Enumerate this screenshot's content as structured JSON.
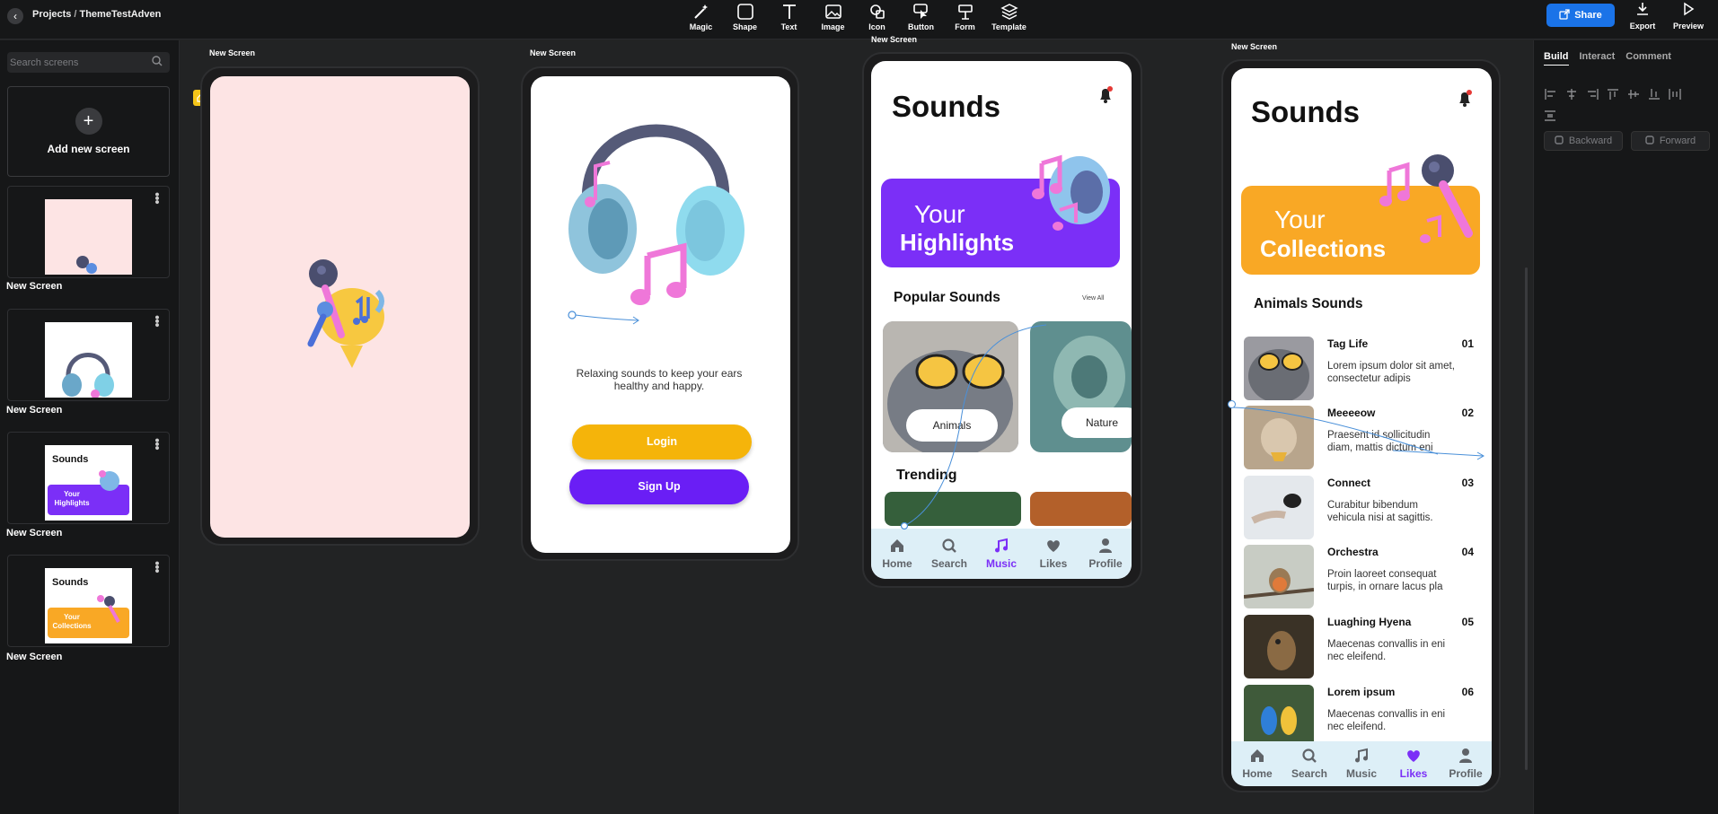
{
  "header": {
    "back_icon": "chevron-left-icon",
    "project": "Projects",
    "separator": "/",
    "file": "ThemeTestAdven",
    "tools": [
      {
        "label": "Magic",
        "icon": "magic-wand-icon"
      },
      {
        "label": "Shape",
        "icon": "square-icon"
      },
      {
        "label": "Text",
        "icon": "text-icon"
      },
      {
        "label": "Image",
        "icon": "image-icon"
      },
      {
        "label": "Icon",
        "icon": "shapes-icon"
      },
      {
        "label": "Button",
        "icon": "pointer-icon"
      },
      {
        "label": "Form",
        "icon": "form-icon"
      },
      {
        "label": "Template",
        "icon": "layers-icon"
      }
    ],
    "share_label": "Share",
    "export_label": "Export",
    "preview_label": "Preview"
  },
  "left_panel": {
    "search_placeholder": "Search screens",
    "add_label": "Add new screen",
    "screens": [
      {
        "name": "New Screen"
      },
      {
        "name": "New Screen"
      },
      {
        "name": "New Screen",
        "title": "Sounds",
        "card": "Your Highlights"
      },
      {
        "name": "New Screen",
        "title": "Sounds",
        "card": "Your Collections"
      }
    ]
  },
  "right_panel": {
    "tabs": [
      "Build",
      "Interact",
      "Comment"
    ],
    "active_tab": "Build",
    "backward_label": "Backward",
    "forward_label": "Forward"
  },
  "canvas": {
    "screen1": {
      "label": "New Screen"
    },
    "screen2": {
      "label": "New Screen",
      "tagline": "Relaxing sounds to keep your ears healthy and happy.",
      "login": "Login",
      "signup": "Sign Up"
    },
    "screen3": {
      "label": "New Screen",
      "title": "Sounds",
      "card_line1": "Your",
      "card_line2": "Highlights",
      "section": "Popular Sounds",
      "view_all": "View All",
      "cards": [
        "Animals",
        "Nature"
      ],
      "trending": "Trending"
    },
    "screen4": {
      "label": "New Screen",
      "title": "Sounds",
      "card_line1": "Your",
      "card_line2": "Collections",
      "section": "Animals Sounds",
      "items": [
        {
          "title": "Tag Life",
          "num": "01",
          "desc": "Lorem ipsum dolor sit amet, consectetur adipis"
        },
        {
          "title": "Meeeeow",
          "num": "02",
          "desc": "Praesent id sollicitudin diam, mattis dictum eni"
        },
        {
          "title": "Connect",
          "num": "03",
          "desc": "Curabitur bibendum vehicula nisi at sagittis."
        },
        {
          "title": "Orchestra",
          "num": "04",
          "desc": "Proin laoreet consequat turpis, in ornare lacus pla"
        },
        {
          "title": "Luaghing Hyena",
          "num": "05",
          "desc": "Maecenas convallis in eni nec eleifend."
        },
        {
          "title": "Lorem ipsum",
          "num": "06",
          "desc": "Maecenas convallis in eni nec eleifend."
        }
      ]
    },
    "nav": [
      "Home",
      "Search",
      "Music",
      "Likes",
      "Profile"
    ]
  },
  "colors": {
    "accent_purple": "#7b2ff7",
    "accent_orange": "#f9a825",
    "login_yellow": "#f5b40a",
    "share_blue": "#1a73e8",
    "splash_pink": "#fde4e4"
  }
}
